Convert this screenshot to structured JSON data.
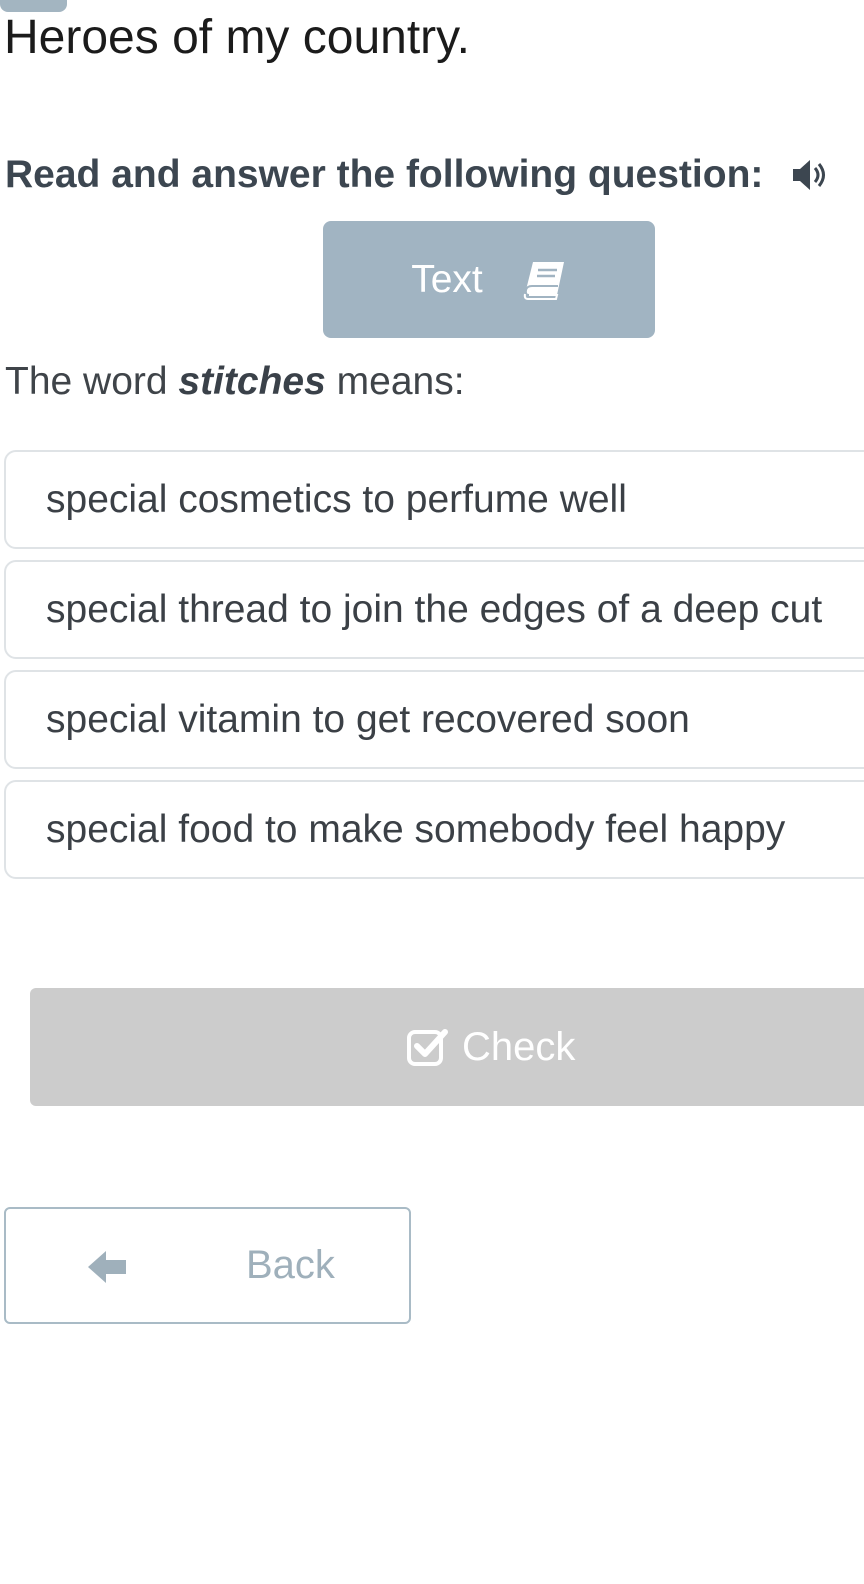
{
  "header": {
    "title": "Heroes of my country."
  },
  "instruction": {
    "text": "Read and answer the following question:",
    "audio_icon": "speaker-icon"
  },
  "text_button": {
    "label": "Text",
    "icon": "book-icon"
  },
  "question": {
    "prefix": "The word ",
    "keyword": "stitches",
    "suffix": " means:"
  },
  "options": [
    {
      "label": "special cosmetics to perfume well"
    },
    {
      "label": "special thread to join the edges of a deep cut"
    },
    {
      "label": "special vitamin to get recovered soon"
    },
    {
      "label": "special food to make somebody feel happy"
    }
  ],
  "check_button": {
    "label": "Check",
    "icon": "checkbox-check-icon",
    "state": "disabled"
  },
  "back_button": {
    "label": "Back",
    "icon": "arrow-left-icon"
  },
  "colors": {
    "accent": "#a1b4c2",
    "check_disabled": "#cccccc",
    "back_border": "#a9bbc6",
    "text_dark": "#3c4650"
  }
}
